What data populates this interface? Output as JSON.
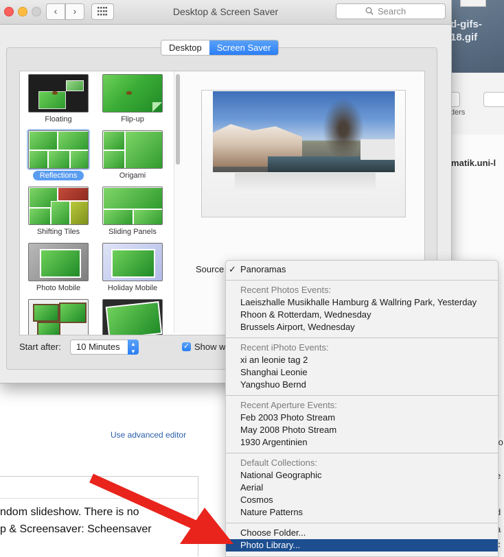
{
  "background": {
    "filename_fragment": "d-gifs-\n18.gif",
    "toolbar_fragment": "ders",
    "host_fragment": "rmatik.uni-l",
    "advanced_link": "Use advanced editor",
    "line1": "ndom slideshow.  There is no",
    "line2": "p & Screensaver: Scheensaver",
    "side_letters": [
      "fo",
      "r",
      "e",
      "d",
      "a",
      "c"
    ]
  },
  "window": {
    "title": "Desktop & Screen Saver",
    "search_placeholder": "Search",
    "back_glyph": "‹",
    "forward_glyph": "›"
  },
  "tabs": {
    "desktop": "Desktop",
    "screen_saver": "Screen Saver",
    "selected": "Screen Saver"
  },
  "modules": [
    {
      "label": "Floating"
    },
    {
      "label": "Flip-up"
    },
    {
      "label": "Reflections",
      "selected": true
    },
    {
      "label": "Origami"
    },
    {
      "label": "Shifting Tiles"
    },
    {
      "label": "Sliding Panels"
    },
    {
      "label": "Photo Mobile"
    },
    {
      "label": "Holiday Mobile"
    },
    {
      "label": ""
    },
    {
      "label": ""
    }
  ],
  "source": {
    "label": "Source"
  },
  "start_after": {
    "label": "Start after:",
    "value": "10 Minutes"
  },
  "show_checkbox": {
    "label": "Show w",
    "checked": true
  },
  "menu": {
    "checked_item": "Panoramas",
    "recent_photos_header": "Recent Photos Events:",
    "recent_photos": [
      "Laeiszhalle Musikhalle Hamburg & Wallring Park, Yesterday",
      "Rhoon & Rotterdam, Wednesday",
      "Brussels Airport, Wednesday"
    ],
    "recent_iphoto_header": "Recent iPhoto Events:",
    "recent_iphoto": [
      "xi an leonie tag 2",
      "Shanghai Leonie",
      "Yangshuo Bernd"
    ],
    "recent_aperture_header": "Recent Aperture Events:",
    "recent_aperture": [
      "Feb 2003 Photo Stream",
      "May 2008 Photo Stream",
      "1930 Argentinien"
    ],
    "default_header": "Default Collections:",
    "default_collections": [
      "National Geographic",
      "Aerial",
      "Cosmos",
      "Nature Patterns"
    ],
    "choose_folder": "Choose Folder...",
    "photo_library": "Photo Library...",
    "highlighted": "Photo Library..."
  },
  "colors": {
    "accent_blue": "#2b7ef5",
    "menu_highlight": "#1d4e8f",
    "arrow_red": "#e8241c"
  }
}
